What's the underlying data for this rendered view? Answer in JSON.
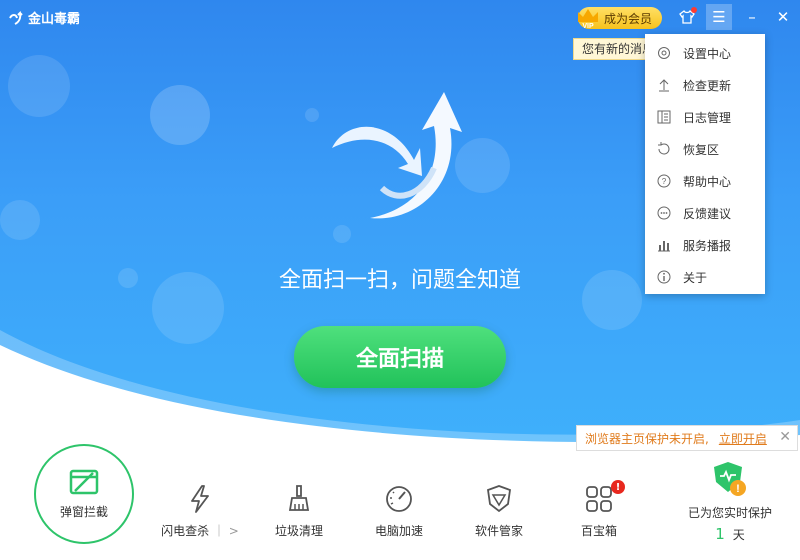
{
  "app": {
    "title": "金山毒霸"
  },
  "titlebar": {
    "vip_label": "成为会员",
    "vip_badge": "VIP",
    "menu_icon": "☰",
    "minimize_icon": "–",
    "close_icon": "✕"
  },
  "tooltip": {
    "text": "您有新的消息"
  },
  "menu": {
    "items": [
      {
        "label": "设置中心",
        "icon": "gear-icon"
      },
      {
        "label": "检查更新",
        "icon": "upload-icon"
      },
      {
        "label": "日志管理",
        "icon": "log-icon"
      },
      {
        "label": "恢复区",
        "icon": "restore-icon"
      },
      {
        "label": "帮助中心",
        "icon": "help-icon"
      },
      {
        "label": "反馈建议",
        "icon": "feedback-icon"
      },
      {
        "label": "服务播报",
        "icon": "chart-icon"
      },
      {
        "label": "关于",
        "icon": "info-icon"
      }
    ]
  },
  "main": {
    "slogan": "全面扫一扫，问题全知道",
    "scan_button": "全面扫描"
  },
  "notice": {
    "text": "浏览器主页保护未开启,",
    "link": "立即开启"
  },
  "tools": {
    "popup_block": "弹窗拦截",
    "items": [
      {
        "label": "闪电查杀",
        "suffix": "｜ >"
      },
      {
        "label": "垃圾清理"
      },
      {
        "label": "电脑加速"
      },
      {
        "label": "软件管家"
      },
      {
        "label": "百宝箱",
        "badge": "!"
      }
    ]
  },
  "protection": {
    "label": "已为您实时保护",
    "days": "1",
    "unit": "天"
  },
  "colors": {
    "hero_top": "#2f87ee",
    "hero_bottom": "#3fb0fb",
    "accent_green": "#2ec46a",
    "warning_orange": "#e07b1c",
    "vip_gold": "#f7c21c"
  }
}
